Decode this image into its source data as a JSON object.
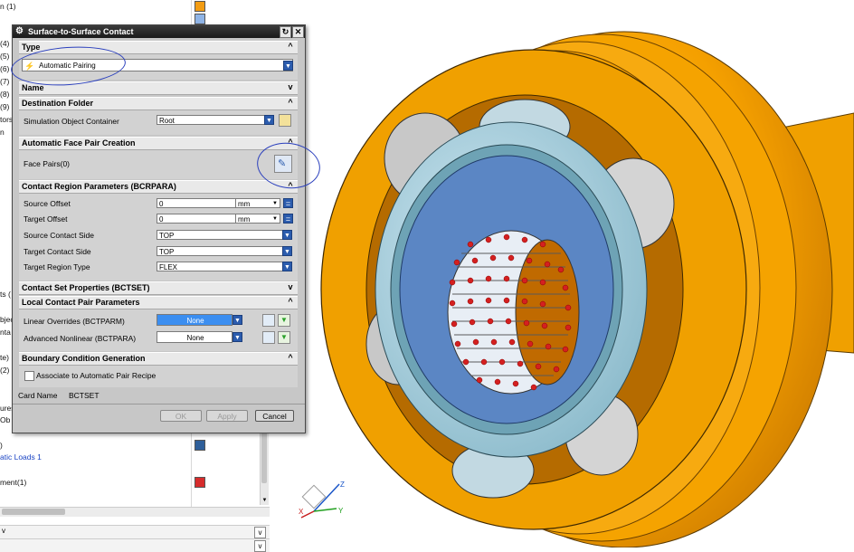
{
  "navigator": {
    "rows": [
      {
        "text": "n (1)",
        "swatch": "#f39c12"
      },
      {
        "text": "",
        "swatch": "#8fb4e6"
      },
      {
        "text": "(4)"
      },
      {
        "text": "(5)"
      },
      {
        "text": "(6)"
      },
      {
        "text": "(7)"
      },
      {
        "text": "(8)"
      },
      {
        "text": "(9)"
      },
      {
        "text": "tors"
      },
      {
        "text": "n"
      }
    ],
    "mid_rows": [
      "ts (",
      "bjec",
      "nta",
      "te)",
      "(2)"
    ],
    "lower_rows": [
      {
        "text": "ures"
      },
      {
        "text": "Ob"
      },
      {
        "text": ")",
        "swatch": "#2f5f9a"
      },
      {
        "text": "atic Loads 1",
        "link": true
      },
      {
        "text": "ment(1)",
        "swatch": "#d62c2c"
      }
    ],
    "bottom_bar_label": "v"
  },
  "dialog": {
    "title": "Surface-to-Surface Contact",
    "reset_icon": "↻",
    "close_icon": "✕",
    "type_section": {
      "label": "Type",
      "value": "Automatic Pairing"
    },
    "name_section": {
      "label": "Name"
    },
    "destination": {
      "label": "Destination Folder",
      "field_label": "Simulation Object Container",
      "value": "Root"
    },
    "auto_face": {
      "label": "Automatic Face Pair Creation",
      "field_label": "Face Pairs(0)"
    },
    "region": {
      "label": "Contact Region Parameters (BCRPARA)",
      "rows": [
        {
          "label": "Source Offset",
          "value": "0",
          "unit": "mm"
        },
        {
          "label": "Target Offset",
          "value": "0",
          "unit": "mm"
        },
        {
          "label": "Source Contact Side",
          "value": "TOP"
        },
        {
          "label": "Target Contact Side",
          "value": "TOP"
        },
        {
          "label": "Target Region Type",
          "value": "FLEX"
        }
      ]
    },
    "contact_set": {
      "label": "Contact Set Properties (BCTSET)"
    },
    "local_pair": {
      "label": "Local Contact Pair Parameters",
      "rows": [
        {
          "label": "Linear Overrides (BCTPARM)",
          "value": "None",
          "highlighted": true
        },
        {
          "label": "Advanced Nonlinear (BCTPARA)",
          "value": "None",
          "highlighted": false
        }
      ]
    },
    "boundary": {
      "label": "Boundary Condition Generation",
      "checkbox_label": "Associate to Automatic Pair Recipe"
    },
    "card_name": {
      "label": "Card Name",
      "value": "BCTSET"
    },
    "buttons": {
      "ok": "OK",
      "apply": "Apply",
      "cancel": "Cancel"
    }
  },
  "colors": {
    "part_orange": "#f5a000",
    "hub_teal": "#7fb2c4",
    "inner_blue": "#5b86c4",
    "mesh_red": "#d42020",
    "annotation_blue": "#2a3fbd"
  }
}
